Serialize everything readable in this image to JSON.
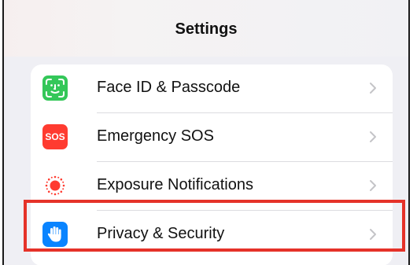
{
  "header": {
    "title": "Settings"
  },
  "settings_list": {
    "items": [
      {
        "label": "Face ID & Passcode",
        "icon": "face-id-icon",
        "icon_color": "#34c759"
      },
      {
        "label": "Emergency SOS",
        "icon": "sos-icon",
        "icon_text": "SOS",
        "icon_color": "#ff3b30"
      },
      {
        "label": "Exposure Notifications",
        "icon": "exposure-icon",
        "icon_color": "#ff3b30"
      },
      {
        "label": "Privacy & Security",
        "icon": "hand-icon",
        "icon_color": "#0a84ff"
      }
    ]
  },
  "highlight": {
    "target": "Privacy & Security",
    "color": "#e53229"
  }
}
